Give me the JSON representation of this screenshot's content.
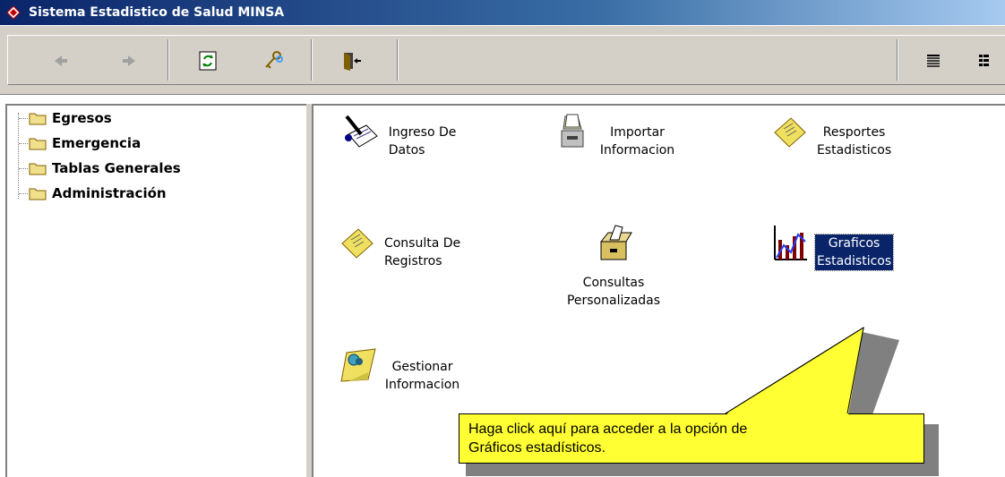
{
  "window": {
    "title": "Sistema Estadistico de Salud  MINSA"
  },
  "toolbar": {
    "buttons": [
      "back-arrow",
      "forward-arrow",
      "refresh",
      "keys",
      "exit-door",
      "list-view",
      "detail-view"
    ]
  },
  "tree": {
    "items": [
      {
        "label": "Egresos"
      },
      {
        "label": "Emergencia"
      },
      {
        "label": "Tablas Generales"
      },
      {
        "label": "Administración"
      }
    ]
  },
  "icons": [
    {
      "line1": "Ingreso De",
      "line2": "Datos",
      "icon": "notepad-pencil-icon"
    },
    {
      "line1": "Importar",
      "line2": "Informacion",
      "icon": "cabinet-folder-icon"
    },
    {
      "line1": "Resportes",
      "line2": "Estadisticos",
      "icon": "sticky-note-icon"
    },
    {
      "line1": "Consulta De",
      "line2": "Registros",
      "icon": "sticky-note-icon"
    },
    {
      "line1": "Consultas",
      "line2": "Personalizadas",
      "icon": "file-box-icon"
    },
    {
      "line1": "Graficos",
      "line2": "Estadisticos",
      "icon": "bar-chart-icon",
      "selected": true
    },
    {
      "line1": "Gestionar",
      "line2": "Informacion",
      "icon": "pin-note-icon"
    }
  ],
  "callout": {
    "line1": "Haga click aquí para acceder a la opción de",
    "line2": "Gráficos estadísticos."
  },
  "colors": {
    "title_bar": "#0a246a",
    "toolbar": "#d4d0c8",
    "selection": "#0a246a",
    "callout": "#ffff33"
  }
}
